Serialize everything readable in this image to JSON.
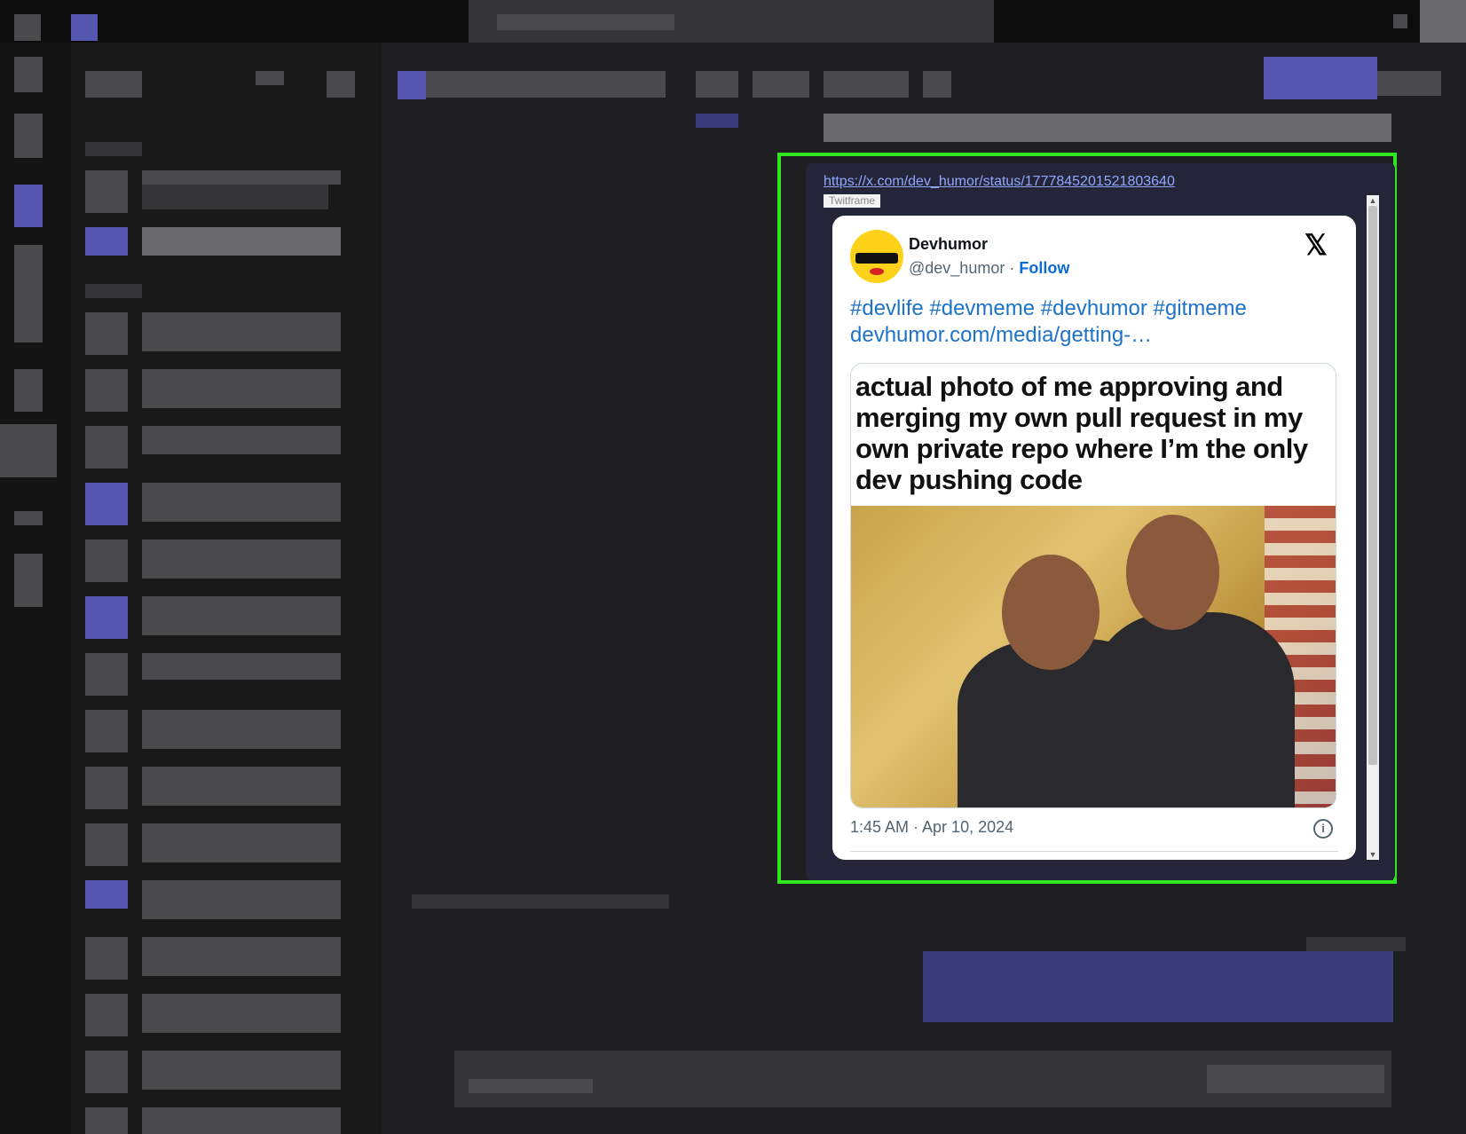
{
  "embed": {
    "link": "https://x.com/dev_humor/status/1777845201521803640",
    "tag": "Twitframe"
  },
  "tweet": {
    "author_name": "Devhumor",
    "author_handle": "@dev_humor",
    "separator": " · ",
    "follow_label": "Follow",
    "text_line1": "#devlife #devmeme #devhumor #gitmeme",
    "text_line2": "devhumor.com/media/getting-…",
    "meme_caption": "actual photo of me approving and merging my own pull request in my own private repo where I’m the only dev pushing code",
    "timestamp": "1:45 AM · Apr 10, 2024",
    "info_glyph": "i",
    "x_glyph": "𝕏"
  },
  "colors": {
    "accent_frame": "#2ee71f",
    "link": "#8fa7ff",
    "tweet_link": "#1d72c9"
  }
}
